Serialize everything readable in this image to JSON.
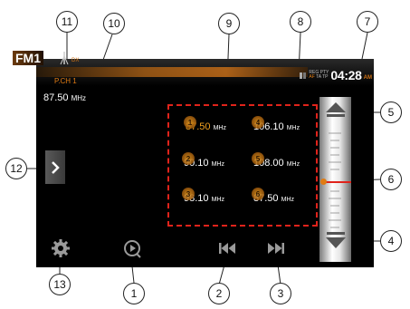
{
  "status": {
    "rds_top": "REG",
    "rds_top2": "PTY",
    "rds_bottom": "AF",
    "rds_bottom2": "TA TP",
    "clock": "04:28",
    "ampm": "AM"
  },
  "radio": {
    "band": "FM1",
    "dx_label": "DX",
    "preset_channel": "P.CH 1",
    "current_freq": "87.50",
    "unit": "MHz"
  },
  "presets": [
    {
      "number": "1",
      "freq": "87.50",
      "unit": "MHz"
    },
    {
      "number": "4",
      "freq": "106.10",
      "unit": "MHz"
    },
    {
      "number": "2",
      "freq": "90.10",
      "unit": "MHz"
    },
    {
      "number": "5",
      "freq": "108.00",
      "unit": "MHz"
    },
    {
      "number": "3",
      "freq": "98.10",
      "unit": "MHz"
    },
    {
      "number": "6",
      "freq": "87.50",
      "unit": "MHz"
    }
  ],
  "callouts": {
    "c1": "1",
    "c2": "2",
    "c3": "3",
    "c4": "4",
    "c5": "5",
    "c6": "6",
    "c7": "7",
    "c8": "8",
    "c9": "9",
    "c10": "10",
    "c11": "11",
    "c12": "12",
    "c13": "13"
  },
  "icons": {
    "settings": "gear-icon",
    "scan": "scan-play-icon",
    "prev": "skip-previous-icon",
    "next": "skip-next-icon",
    "tune_up": "tune-up-arrow-icon",
    "tune_down": "tune-down-arrow-icon",
    "side": "chevron-right-icon",
    "antenna": "antenna-icon"
  },
  "colors": {
    "accent": "#e07b12",
    "highlight": "#e0231b",
    "screen": "#000000"
  }
}
